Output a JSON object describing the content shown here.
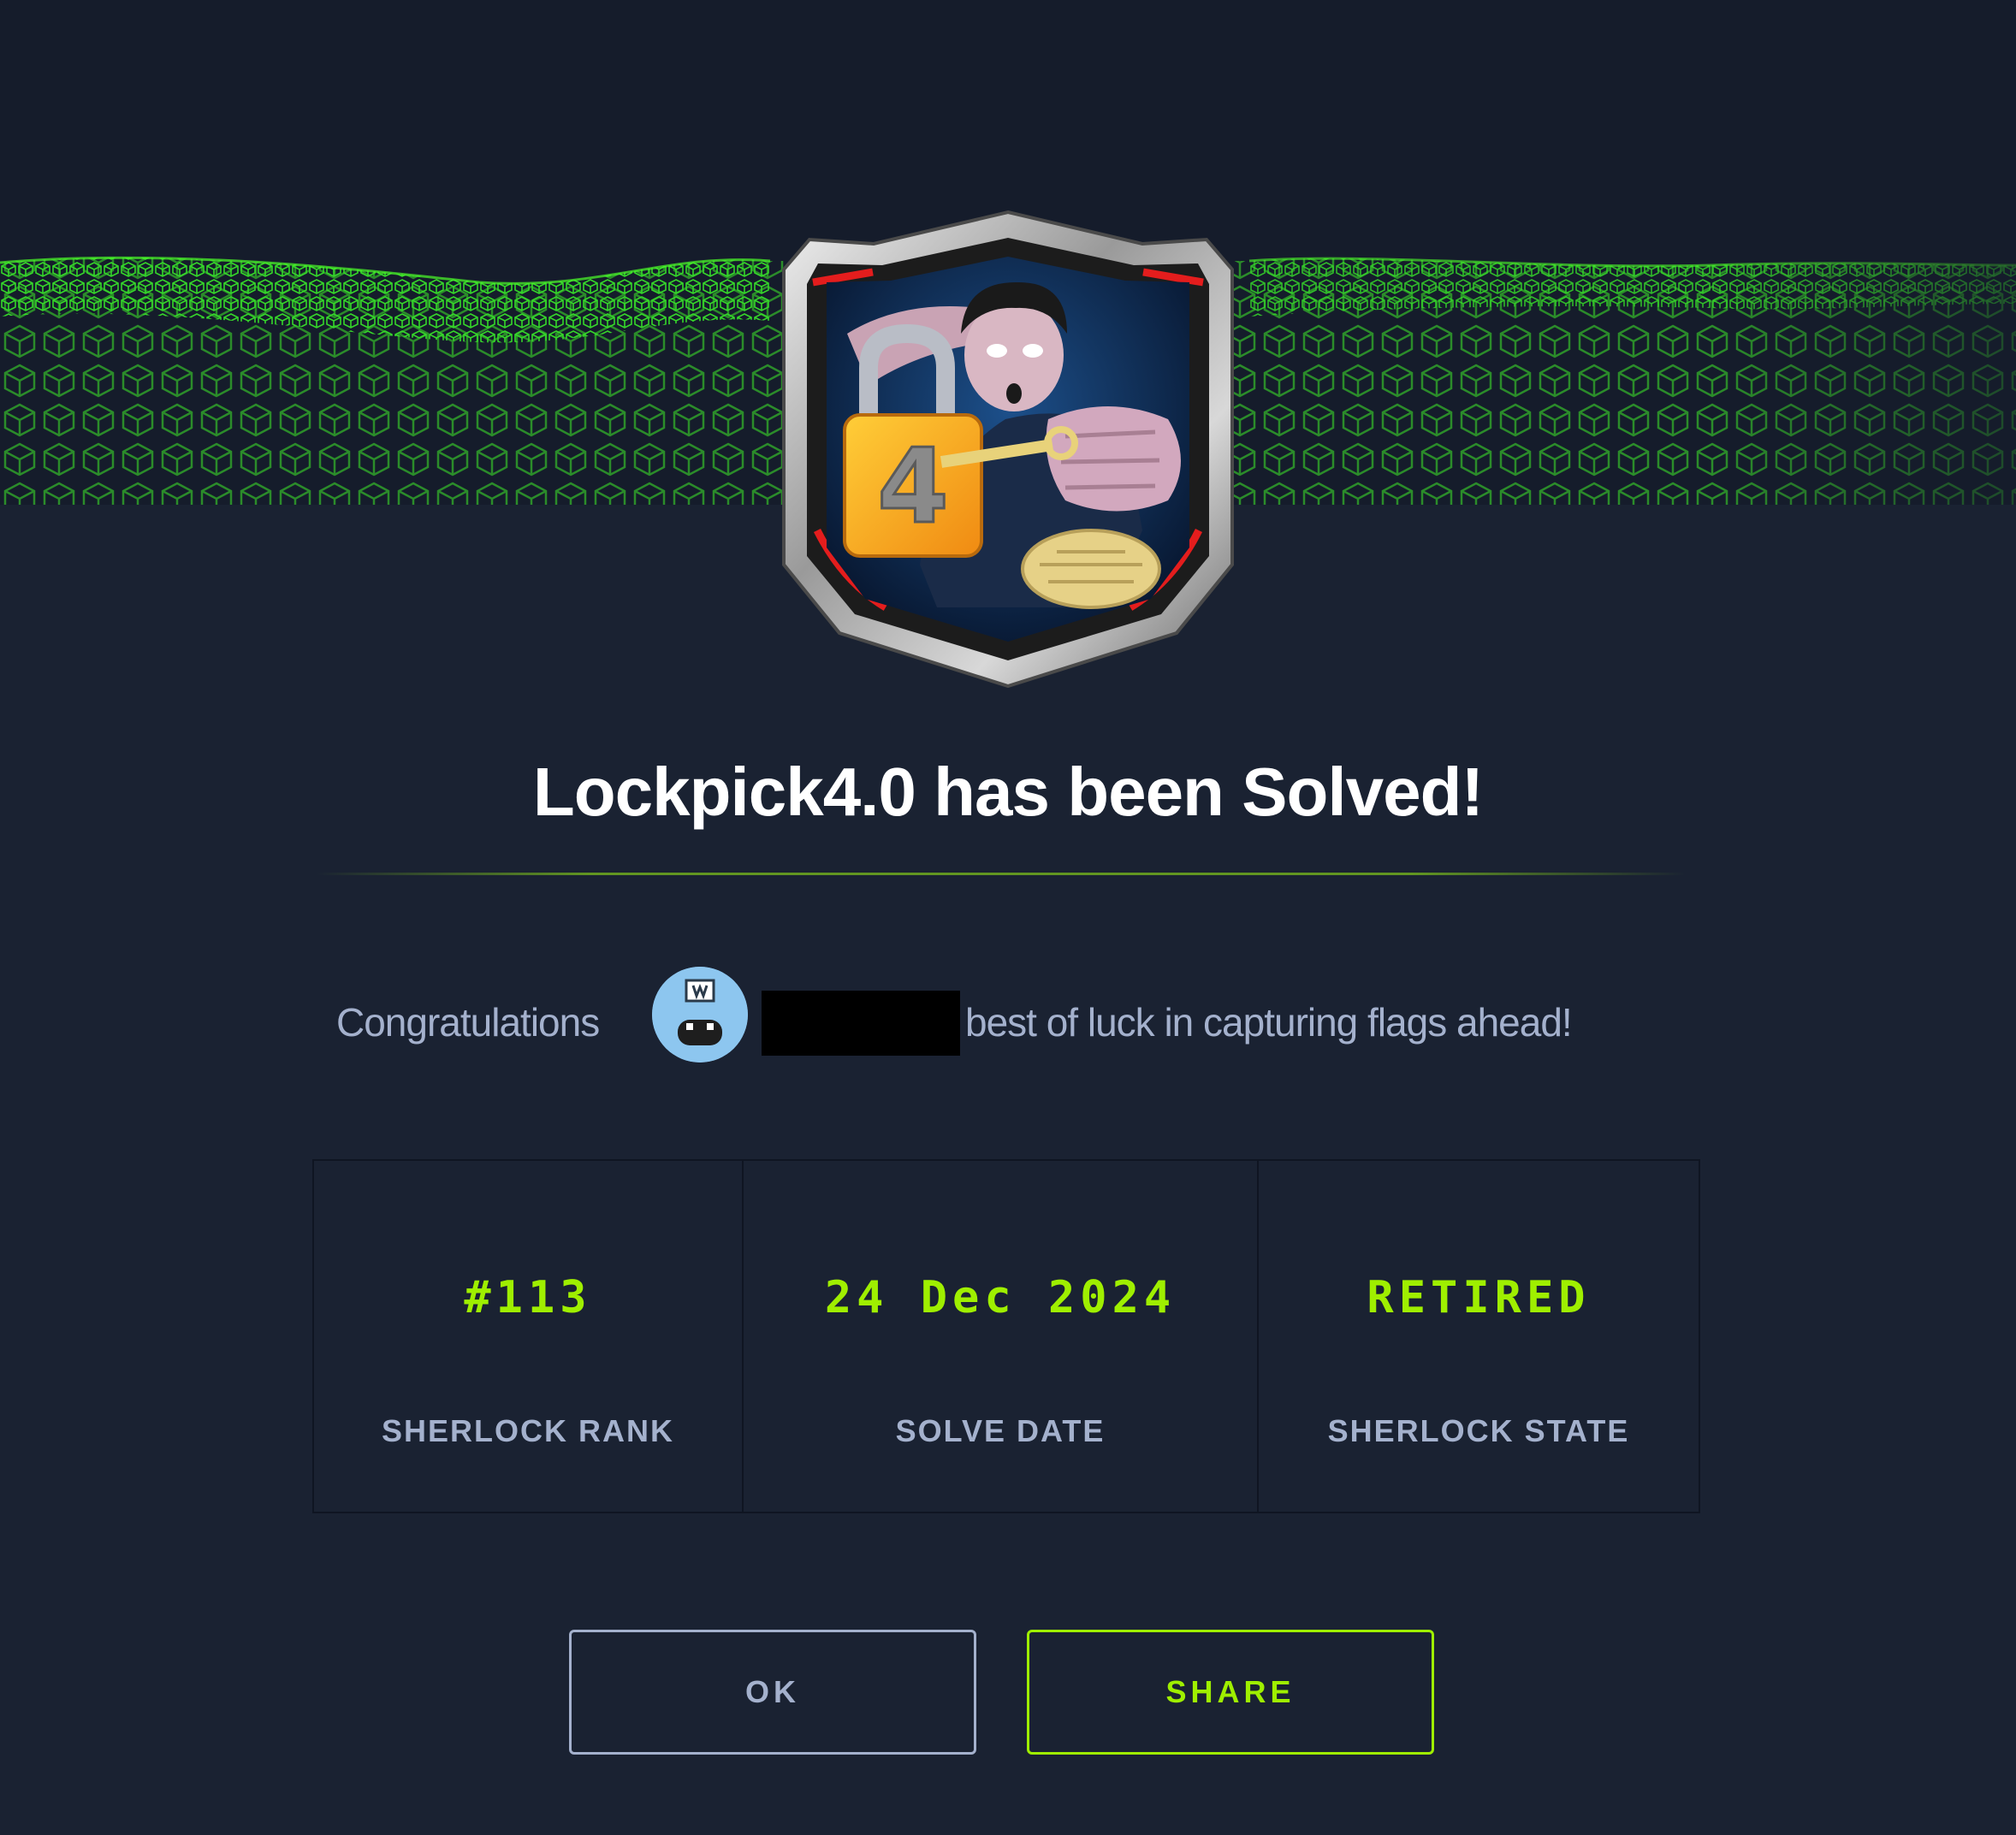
{
  "dialog": {
    "challenge_name": "Lockpick4.0",
    "title": "Lockpick4.0 has been Solved!",
    "congrats_prefix": "Congratulations",
    "congrats_suffix": "best of luck in capturing flags ahead!"
  },
  "badge": {
    "icon": "lockpick-badge-icon",
    "padlock_number": "4"
  },
  "user": {
    "avatar_icon": "user-avatar-icon",
    "username_redacted": true
  },
  "stats": [
    {
      "value": "#113",
      "label": "SHERLOCK RANK"
    },
    {
      "value": "24 Dec 2024",
      "label": "SOLVE DATE"
    },
    {
      "value": "RETIRED",
      "label": "SHERLOCK STATE"
    }
  ],
  "buttons": {
    "ok_label": "OK",
    "share_label": "SHARE"
  },
  "colors": {
    "background": "#1a2232",
    "header_background": "#151c2b",
    "accent": "#9fef00",
    "muted_text": "#a4b1cd",
    "title_text": "#ffffff"
  }
}
